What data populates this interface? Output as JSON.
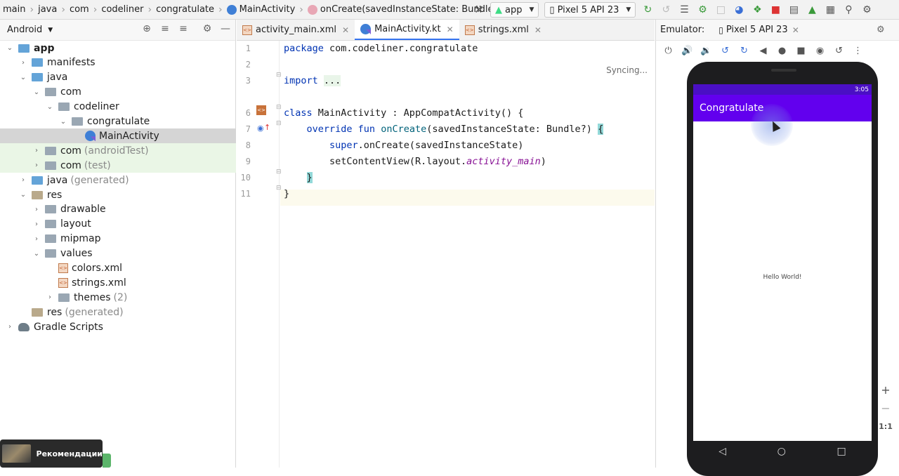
{
  "breadcrumbs": [
    "main",
    "java",
    "com",
    "codeliner",
    "congratulate",
    "MainActivity",
    "onCreate(savedInstanceState: Bundle?)"
  ],
  "toolbar": {
    "run_config": "app",
    "device": "Pixel 5 API 23"
  },
  "project": {
    "view": "Android",
    "tree": [
      {
        "label": "app",
        "extra": "",
        "level": 0,
        "icon": "folder-blue",
        "expanded": true,
        "bold": true
      },
      {
        "label": "manifests",
        "extra": "",
        "level": 1,
        "icon": "folder-blue",
        "expanded": false
      },
      {
        "label": "java",
        "extra": "",
        "level": 1,
        "icon": "folder-blue",
        "expanded": true
      },
      {
        "label": "com",
        "extra": "",
        "level": 2,
        "icon": "folder",
        "expanded": true
      },
      {
        "label": "codeliner",
        "extra": "",
        "level": 3,
        "icon": "folder",
        "expanded": true
      },
      {
        "label": "congratulate",
        "extra": "",
        "level": 4,
        "icon": "folder",
        "expanded": true
      },
      {
        "label": "MainActivity",
        "extra": "",
        "level": 5,
        "icon": "kotlin-class",
        "selected": true
      },
      {
        "label": "com",
        "extra": "(androidTest)",
        "level": 2,
        "icon": "folder",
        "expanded": false
      },
      {
        "label": "com",
        "extra": "(test)",
        "level": 2,
        "icon": "folder",
        "expanded": false
      },
      {
        "label": "java",
        "extra": "(generated)",
        "level": 1,
        "icon": "folder-blue",
        "expanded": false
      },
      {
        "label": "res",
        "extra": "",
        "level": 1,
        "icon": "folder-res",
        "expanded": true
      },
      {
        "label": "drawable",
        "extra": "",
        "level": 2,
        "icon": "folder",
        "expanded": false
      },
      {
        "label": "layout",
        "extra": "",
        "level": 2,
        "icon": "folder",
        "expanded": false
      },
      {
        "label": "mipmap",
        "extra": "",
        "level": 2,
        "icon": "folder",
        "expanded": false
      },
      {
        "label": "values",
        "extra": "",
        "level": 2,
        "icon": "folder",
        "expanded": true
      },
      {
        "label": "colors.xml",
        "extra": "",
        "level": 3,
        "icon": "xml-file"
      },
      {
        "label": "strings.xml",
        "extra": "",
        "level": 3,
        "icon": "xml-file"
      },
      {
        "label": "themes",
        "extra": "(2)",
        "level": 3,
        "icon": "folder",
        "expanded": false
      },
      {
        "label": "res",
        "extra": "(generated)",
        "level": 1,
        "icon": "folder-res"
      },
      {
        "label": "Gradle Scripts",
        "extra": "",
        "level": 0,
        "icon": "gradle",
        "expanded": false
      }
    ]
  },
  "editor": {
    "tabs": [
      {
        "label": "activity_main.xml",
        "active": false
      },
      {
        "label": "MainActivity.kt",
        "active": true
      },
      {
        "label": "strings.xml",
        "active": false
      }
    ],
    "status": "Syncing...",
    "line_numbers": [
      "1",
      "2",
      "3",
      "6",
      "7",
      "8",
      "9",
      "10",
      "11"
    ],
    "code": {
      "l1_kw": "package",
      "l1_rest": " com.codeliner.congratulate",
      "l3_kw": "import",
      "l3_fold": "...",
      "l6_kw": "class",
      "l6_rest": " MainActivity : AppCompatActivity() {",
      "l7_kw": "override fun",
      "l7_fn": "onCreate",
      "l7_rest": "(savedInstanceState: Bundle?) ",
      "l7_brace": "{",
      "l8_kw": "super",
      "l8_rest": ".onCreate(savedInstanceState)",
      "l9_a": "setContentView(R.layout.",
      "l9_it": "activity_main",
      "l9_b": ")",
      "l10": "}",
      "l11": "}"
    }
  },
  "emulator": {
    "label": "Emulator:",
    "tab": "Pixel 5 API 23",
    "time": "3:05",
    "app_title": "Congratulate",
    "content": "Hello World!",
    "zoom_label": "1:1"
  },
  "overlay": {
    "recommend": "Рекомендации"
  }
}
